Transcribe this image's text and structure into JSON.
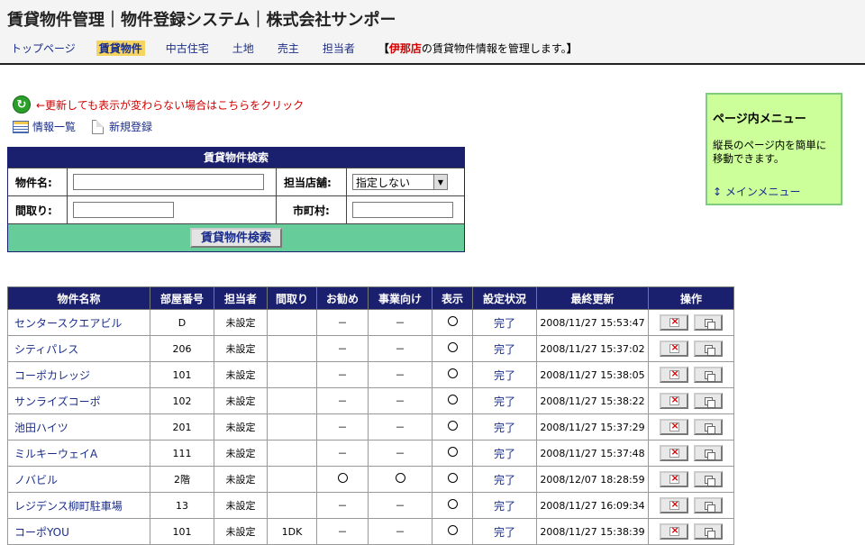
{
  "header": {
    "title": "賃貸物件管理｜物件登録システム｜株式会社サンポー",
    "nav": [
      {
        "label": "トップページ",
        "active": false
      },
      {
        "label": "賃貸物件",
        "active": true
      },
      {
        "label": "中古住宅",
        "active": false
      },
      {
        "label": "土地",
        "active": false
      },
      {
        "label": "売主",
        "active": false
      },
      {
        "label": "担当者",
        "active": false
      }
    ],
    "note_open": "【",
    "note_store": "伊那店",
    "note_text": "の賃貸物件情報を管理します。",
    "note_close": "】"
  },
  "refresh": {
    "icon": "refresh-icon",
    "text": "←更新しても表示が変わらない場合はこちらをクリック"
  },
  "links": {
    "list_label": "情報一覧",
    "new_label": "新規登録"
  },
  "search": {
    "heading": "賃貸物件検索",
    "name_label": "物件名:",
    "name_value": "",
    "store_label": "担当店舗:",
    "store_selected": "指定しない",
    "layout_label": "間取り:",
    "layout_value": "",
    "city_label": "市町村:",
    "city_value": "",
    "button_label": "賃貸物件検索"
  },
  "sidebox": {
    "title": "ページ内メニュー",
    "desc": "縦長のページ内を簡単に移動できます。",
    "link": "↕ メインメニュー"
  },
  "table": {
    "headers": [
      "物件名称",
      "部屋番号",
      "担当者",
      "間取り",
      "お勧め",
      "事業向け",
      "表示",
      "設定状況",
      "最終更新",
      "操作"
    ],
    "rows": [
      {
        "name": "センタースクエアビル",
        "room": "D",
        "staff": "未設定",
        "layout": "",
        "recommend": "－",
        "business": "－",
        "display": "○",
        "status": "完了",
        "updated": "2008/11/27 15:53:47"
      },
      {
        "name": "シティパレス",
        "room": "206",
        "staff": "未設定",
        "layout": "",
        "recommend": "－",
        "business": "－",
        "display": "○",
        "status": "完了",
        "updated": "2008/11/27 15:37:02"
      },
      {
        "name": "コーポカレッジ",
        "room": "101",
        "staff": "未設定",
        "layout": "",
        "recommend": "－",
        "business": "－",
        "display": "○",
        "status": "完了",
        "updated": "2008/11/27 15:38:05"
      },
      {
        "name": "サンライズコーポ",
        "room": "102",
        "staff": "未設定",
        "layout": "",
        "recommend": "－",
        "business": "－",
        "display": "○",
        "status": "完了",
        "updated": "2008/11/27 15:38:22"
      },
      {
        "name": "池田ハイツ",
        "room": "201",
        "staff": "未設定",
        "layout": "",
        "recommend": "－",
        "business": "－",
        "display": "○",
        "status": "完了",
        "updated": "2008/11/27 15:37:29"
      },
      {
        "name": "ミルキーウェイA",
        "room": "111",
        "staff": "未設定",
        "layout": "",
        "recommend": "－",
        "business": "－",
        "display": "○",
        "status": "完了",
        "updated": "2008/11/27 15:37:48"
      },
      {
        "name": "ノバビル",
        "room": "2階",
        "staff": "未設定",
        "layout": "",
        "recommend": "○",
        "business": "○",
        "display": "○",
        "status": "完了",
        "updated": "2008/12/07 18:28:59"
      },
      {
        "name": "レジデンス柳町駐車場",
        "room": "13",
        "staff": "未設定",
        "layout": "",
        "recommend": "－",
        "business": "－",
        "display": "○",
        "status": "完了",
        "updated": "2008/11/27 16:09:34"
      },
      {
        "name": "コーポYOU",
        "room": "101",
        "staff": "未設定",
        "layout": "1DK",
        "recommend": "－",
        "business": "－",
        "display": "○",
        "status": "完了",
        "updated": "2008/11/27 15:38:39"
      }
    ]
  },
  "colors": {
    "header_bg": "#1a1f6e",
    "search_btn_bg": "#66cc99",
    "sidebox_bg": "#ccff99",
    "accent_red": "#d30000",
    "link": "#1a2d8a"
  }
}
